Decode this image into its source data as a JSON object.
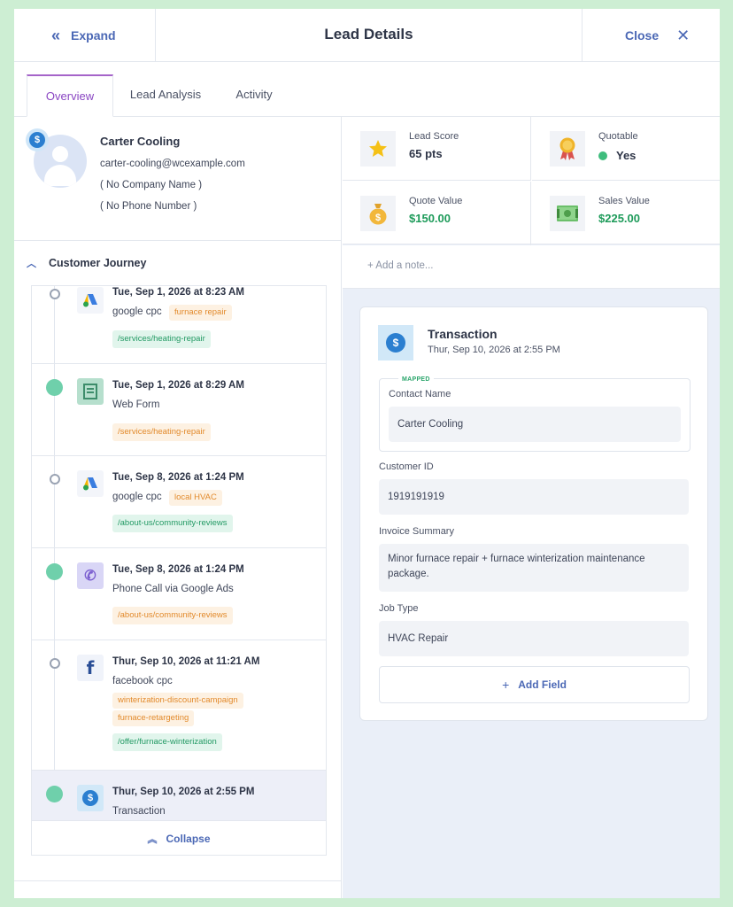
{
  "header": {
    "expand_label": "Expand",
    "title": "Lead Details",
    "close_label": "Close"
  },
  "tabs": [
    {
      "label": "Overview",
      "active": true
    },
    {
      "label": "Lead Analysis",
      "active": false
    },
    {
      "label": "Activity",
      "active": false
    }
  ],
  "profile": {
    "name": "Carter Cooling",
    "email": "carter-cooling@wcexample.com",
    "company": "( No Company Name )",
    "phone": "( No Phone Number )"
  },
  "journey": {
    "heading": "Customer Journey",
    "collapse_label": "Collapse",
    "entries": [
      {
        "date": "Tue, Sep 1, 2026 at 8:23 AM",
        "source": "google cpc",
        "tags": [
          "furnace repair"
        ],
        "path": "/services/heating-repair",
        "icon": "google-ads-icon"
      },
      {
        "date": "Tue, Sep 1, 2026 at 8:29 AM",
        "source": "Web Form",
        "path": "/services/heating-repair",
        "icon": "web-form-icon"
      },
      {
        "date": "Tue, Sep 8, 2026 at 1:24 PM",
        "source": "google cpc",
        "tags": [
          "local HVAC"
        ],
        "path": "/about-us/community-reviews",
        "icon": "google-ads-icon"
      },
      {
        "date": "Tue, Sep 8, 2026 at 1:24 PM",
        "source": "Phone Call via Google Ads",
        "path": "/about-us/community-reviews",
        "icon": "phone-icon"
      },
      {
        "date": "Thur, Sep 10, 2026 at 11:21 AM",
        "source": "facebook cpc",
        "tags": [
          "winterization-discount-campaign",
          "furnace-retargeting"
        ],
        "path": "/offer/furnace-winterization",
        "icon": "facebook-icon"
      },
      {
        "date": "Thur, Sep 10, 2026 at 2:55 PM",
        "source": "Transaction",
        "icon": "dollar-icon"
      }
    ]
  },
  "stats": {
    "lead_score": {
      "label": "Lead Score",
      "value": "65 pts"
    },
    "quotable": {
      "label": "Quotable",
      "value": "Yes"
    },
    "quote_value": {
      "label": "Quote Value",
      "value": "$150.00"
    },
    "sales_value": {
      "label": "Sales Value",
      "value": "$225.00"
    }
  },
  "note_placeholder": "+ Add a note...",
  "transaction": {
    "title": "Transaction",
    "date": "Thur, Sep 10, 2026 at 2:55 PM",
    "mapped_badge": "MAPPED",
    "fields": [
      {
        "label": "Contact Name",
        "value": "Carter Cooling"
      },
      {
        "label": "Customer ID",
        "value": "1919191919"
      },
      {
        "label": "Invoice Summary",
        "value": "Minor furnace repair + furnace winterization maintenance package."
      },
      {
        "label": "Job Type",
        "value": "HVAC Repair"
      }
    ],
    "add_field_label": "Add Field"
  },
  "colors": {
    "accent": "#4b68b5",
    "tab_active": "#8a46c3",
    "green": "#1e9b5a",
    "background": "#cdeed3"
  }
}
